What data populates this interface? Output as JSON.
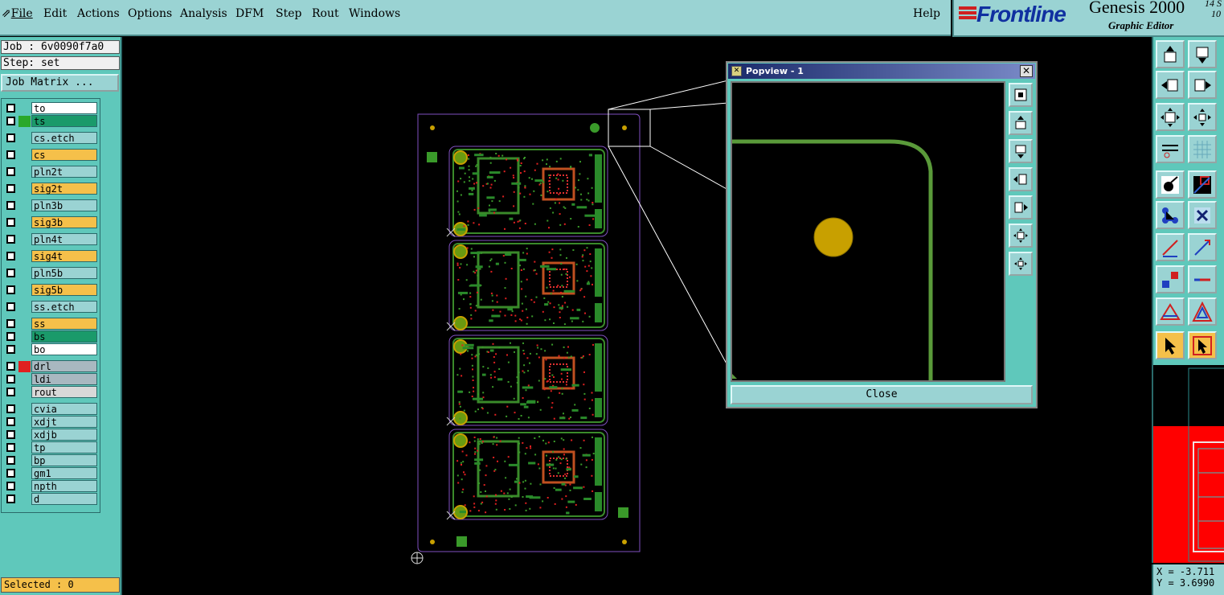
{
  "menubar": {
    "items": [
      {
        "label": "File"
      },
      {
        "label": "Edit"
      },
      {
        "label": "Actions"
      },
      {
        "label": "Options"
      },
      {
        "label": "Analysis"
      },
      {
        "label": "DFM"
      },
      {
        "label": "Step"
      },
      {
        "label": "Rout"
      },
      {
        "label": "Windows"
      }
    ],
    "help": "Help"
  },
  "brand": {
    "logo": "Frontline",
    "product": "Genesis 2000",
    "subtitle": "Graphic Editor",
    "version_line1": "14 S",
    "version_line2": "10"
  },
  "left_panel": {
    "job": "Job : 6v0090f7a0",
    "step": "Step: set",
    "job_matrix_label": "Job Matrix ...",
    "selected": "Selected : 0",
    "layers": [
      {
        "name": "to",
        "color": "#ffffff",
        "swatch": ""
      },
      {
        "name": "ts",
        "color": "#1a9a6a",
        "swatch": "#2aa82a"
      },
      {
        "name": "cs.etch",
        "color": "#9ad3d3",
        "swatch": ""
      },
      {
        "name": "cs",
        "color": "#f5c04a",
        "swatch": ""
      },
      {
        "name": "pln2t",
        "color": "#9ad3d3",
        "swatch": ""
      },
      {
        "name": "sig2t",
        "color": "#f5c04a",
        "swatch": ""
      },
      {
        "name": "pln3b",
        "color": "#9ad3d3",
        "swatch": ""
      },
      {
        "name": "sig3b",
        "color": "#f5c04a",
        "swatch": ""
      },
      {
        "name": "pln4t",
        "color": "#9ad3d3",
        "swatch": ""
      },
      {
        "name": "sig4t",
        "color": "#f5c04a",
        "swatch": ""
      },
      {
        "name": "pln5b",
        "color": "#9ad3d3",
        "swatch": ""
      },
      {
        "name": "sig5b",
        "color": "#f5c04a",
        "swatch": ""
      },
      {
        "name": "ss.etch",
        "color": "#9ad3d3",
        "swatch": ""
      },
      {
        "name": "ss",
        "color": "#f5c04a",
        "swatch": ""
      },
      {
        "name": "bs",
        "color": "#1a9a6a",
        "swatch": ""
      },
      {
        "name": "bo",
        "color": "#ffffff",
        "swatch": ""
      },
      {
        "name": "drl",
        "color": "#a8b8c0",
        "swatch": "#e02020"
      },
      {
        "name": "ldi",
        "color": "#a8b8c0",
        "swatch": ""
      },
      {
        "name": "rout",
        "color": "#d8d8d8",
        "swatch": ""
      },
      {
        "name": "cvia",
        "color": "#9ad3d3",
        "swatch": ""
      },
      {
        "name": "xdjt",
        "color": "#9ad3d3",
        "swatch": ""
      },
      {
        "name": "xdjb",
        "color": "#9ad3d3",
        "swatch": ""
      },
      {
        "name": "tp",
        "color": "#9ad3d3",
        "swatch": ""
      },
      {
        "name": "bp",
        "color": "#9ad3d3",
        "swatch": ""
      },
      {
        "name": "gm1",
        "color": "#9ad3d3",
        "swatch": ""
      },
      {
        "name": "npth",
        "color": "#9ad3d3",
        "swatch": ""
      },
      {
        "name": "d",
        "color": "#9ad3d3",
        "swatch": ""
      }
    ]
  },
  "popview": {
    "title": "Popview - 1",
    "close_label": "Close",
    "tools": [
      "zoom-fit-icon",
      "zoom-home-icon",
      "zoom-home-alt-icon",
      "pan-left-icon",
      "pan-right-icon",
      "zoom-in-icon",
      "zoom-out-icon"
    ]
  },
  "coords": {
    "x": "X = -3.711",
    "y": "Y = 3.6990"
  },
  "colors": {
    "panel": "#5fc8bb",
    "menubar": "#9ad3d3",
    "accent_orange": "#f5c04a",
    "copper_green": "#4a8a2a",
    "pad_gold": "#c8a000",
    "drill_red": "#e02020"
  },
  "right_toolbar": {
    "icons": [
      "move-up-icon",
      "move-down-icon",
      "move-left-icon",
      "move-right-icon",
      "fit-icon",
      "zoom-icon",
      "measure-icon",
      "grid-icon",
      "select-feature-icon",
      "color-select-icon",
      "connect-icon",
      "cross-icon",
      "line-red-icon",
      "line-blue-icon",
      "pad-icon",
      "split-icon",
      "triangle-icon",
      "triangle-outline-icon",
      "pointer-icon",
      "pointer-select-icon"
    ]
  }
}
